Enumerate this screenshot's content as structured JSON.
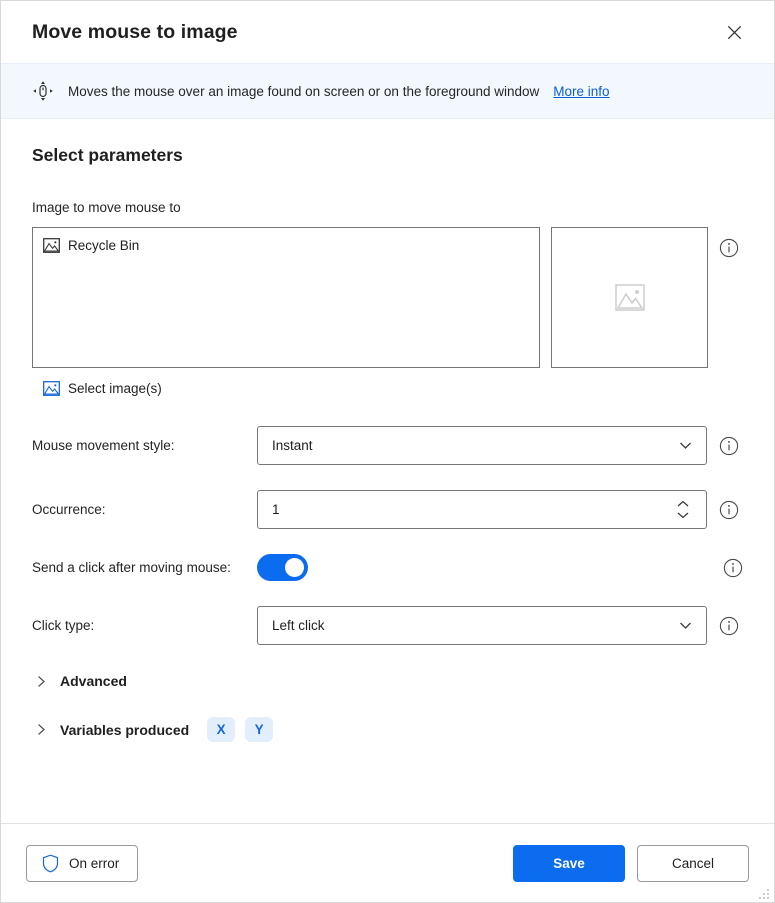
{
  "window": {
    "title": "Move mouse to image",
    "close_icon": "close-icon"
  },
  "infobar": {
    "icon": "move-mouse-icon",
    "description": "Moves the mouse over an image found on screen or on the foreground window",
    "link_label": "More info",
    "background": "#f3f7fe",
    "link_color": "#0a5fd4"
  },
  "main": {
    "section_heading": "Select parameters",
    "image_field": {
      "label": "Image to move mouse to",
      "items": [
        {
          "icon": "picture-icon",
          "label": "Recycle Bin"
        }
      ],
      "preview_placeholder_icon": "picture-placeholder-icon",
      "select_images_label": "Select image(s)",
      "select_images_icon": "picture-icon-blue",
      "info_icon": "info-icon"
    },
    "fields": [
      {
        "name": "mouse-movement-style",
        "label": "Mouse movement style:",
        "type": "dropdown",
        "value": "Instant",
        "info_icon": "info-icon"
      },
      {
        "name": "occurrence",
        "label": "Occurrence:",
        "type": "number",
        "value": "1",
        "info_icon": "info-icon"
      },
      {
        "name": "send-click-after-moving-mouse",
        "label": "Send a click after moving mouse:",
        "type": "toggle",
        "value": "on",
        "accent": "#0b6cf0",
        "info_icon": "info-icon"
      },
      {
        "name": "click-type",
        "label": "Click type:",
        "type": "dropdown",
        "value": "Left click",
        "info_icon": "info-icon"
      }
    ],
    "sections": [
      {
        "name": "advanced",
        "label": "Advanced",
        "expanded": false,
        "chips": []
      },
      {
        "name": "variables-produced",
        "label": "Variables produced",
        "expanded": false,
        "chips": [
          "X",
          "Y"
        ]
      }
    ]
  },
  "footer": {
    "on_error_label": "On error",
    "on_error_icon": "shield-icon",
    "save_label": "Save",
    "cancel_label": "Cancel",
    "primary_color": "#0b6cf0",
    "resize_grip_icon": "resize-grip-icon"
  }
}
